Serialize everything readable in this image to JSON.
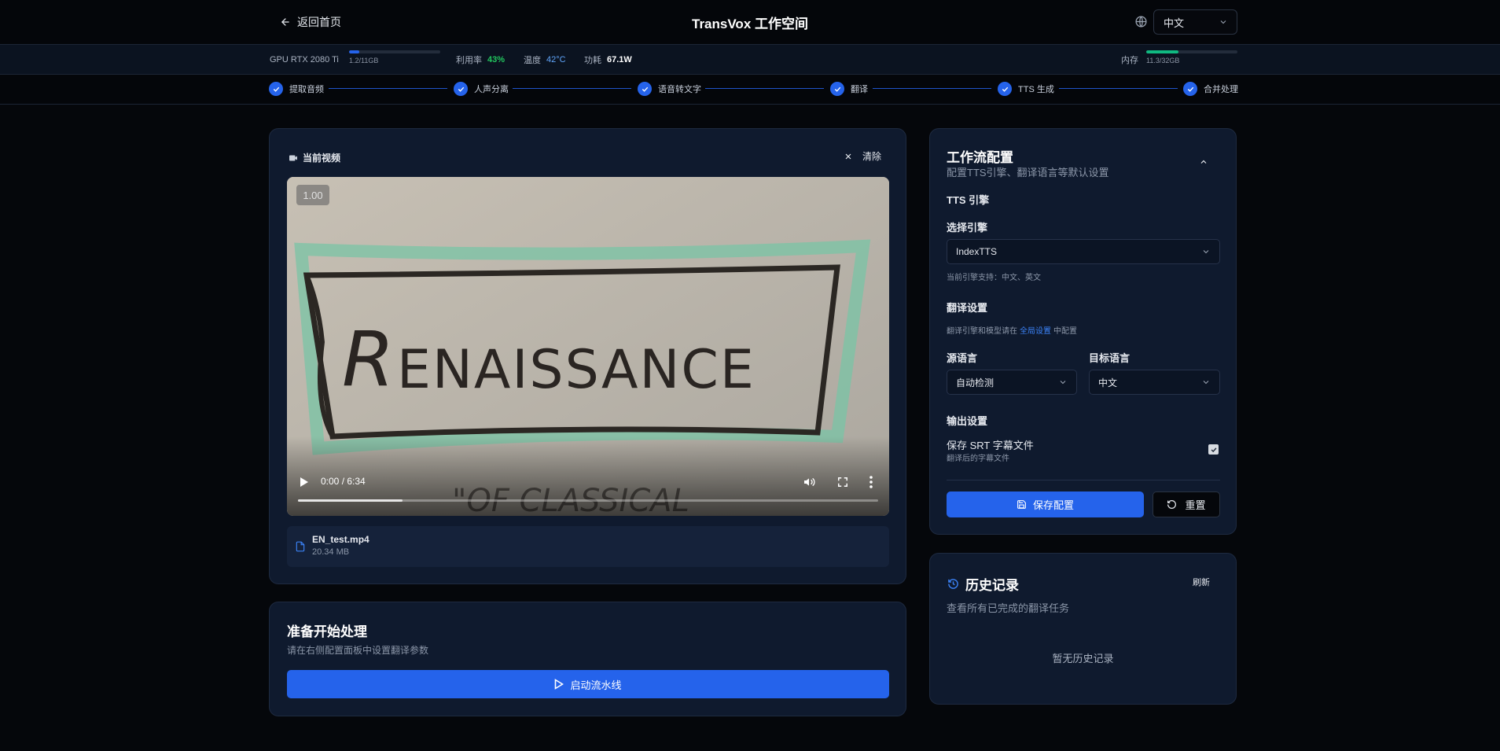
{
  "header": {
    "back_label": "返回首页",
    "title": "TransVox 工作空间",
    "language": "中文"
  },
  "gpu": {
    "name": "GPU RTX 2080 Ti",
    "vram_text": "1.2/11GB",
    "vram_fraction": 0.11,
    "util_label": "利用率",
    "util_value": "43%",
    "temp_label": "温度",
    "temp_value": "42°C",
    "power_label": "功耗",
    "power_value": "67.1W",
    "mem_label": "内存",
    "mem_text": "11.3/32GB",
    "mem_fraction": 0.35
  },
  "steps": [
    "提取音频",
    "人声分离",
    "语音转文字",
    "翻译",
    "TTS 生成",
    "合并处理"
  ],
  "video_card": {
    "title": "当前视频",
    "clear_label": "清除",
    "speed_badge": "1.00",
    "time_text": "0:00 / 6:34",
    "progress_fraction": 0.18,
    "file_name": "EN_test.mp4",
    "file_size": "20.34 MB"
  },
  "start_card": {
    "title": "准备开始处理",
    "subtitle": "请在右侧配置面板中设置翻译参数",
    "button_label": "启动流水线"
  },
  "config": {
    "title": "工作流配置",
    "subtitle": "配置TTS引擎、翻译语言等默认设置",
    "tts_section": "TTS 引擎",
    "engine_label": "选择引擎",
    "engine_value": "IndexTTS",
    "engine_support": "当前引擎支持：中文、英文",
    "translate_section": "翻译设置",
    "translate_note_prefix": "翻译引擎和模型请在",
    "translate_note_link": "全局设置",
    "translate_note_suffix": "中配置",
    "source_label": "源语言",
    "source_value": "自动检测",
    "target_label": "目标语言",
    "target_value": "中文",
    "output_section": "输出设置",
    "srt_label": "保存 SRT 字幕文件",
    "srt_sub": "翻译后的字幕文件",
    "srt_checked": true,
    "save_label": "保存配置",
    "reset_label": "重置"
  },
  "history": {
    "title": "历史记录",
    "refresh_label": "刷新",
    "subtitle": "查看所有已完成的翻译任务",
    "empty_text": "暂无历史记录"
  },
  "colors": {
    "accent": "#2563eb",
    "util_green": "#22c55e",
    "temp_blue": "#60a5fa",
    "mem_green": "#10b981"
  }
}
